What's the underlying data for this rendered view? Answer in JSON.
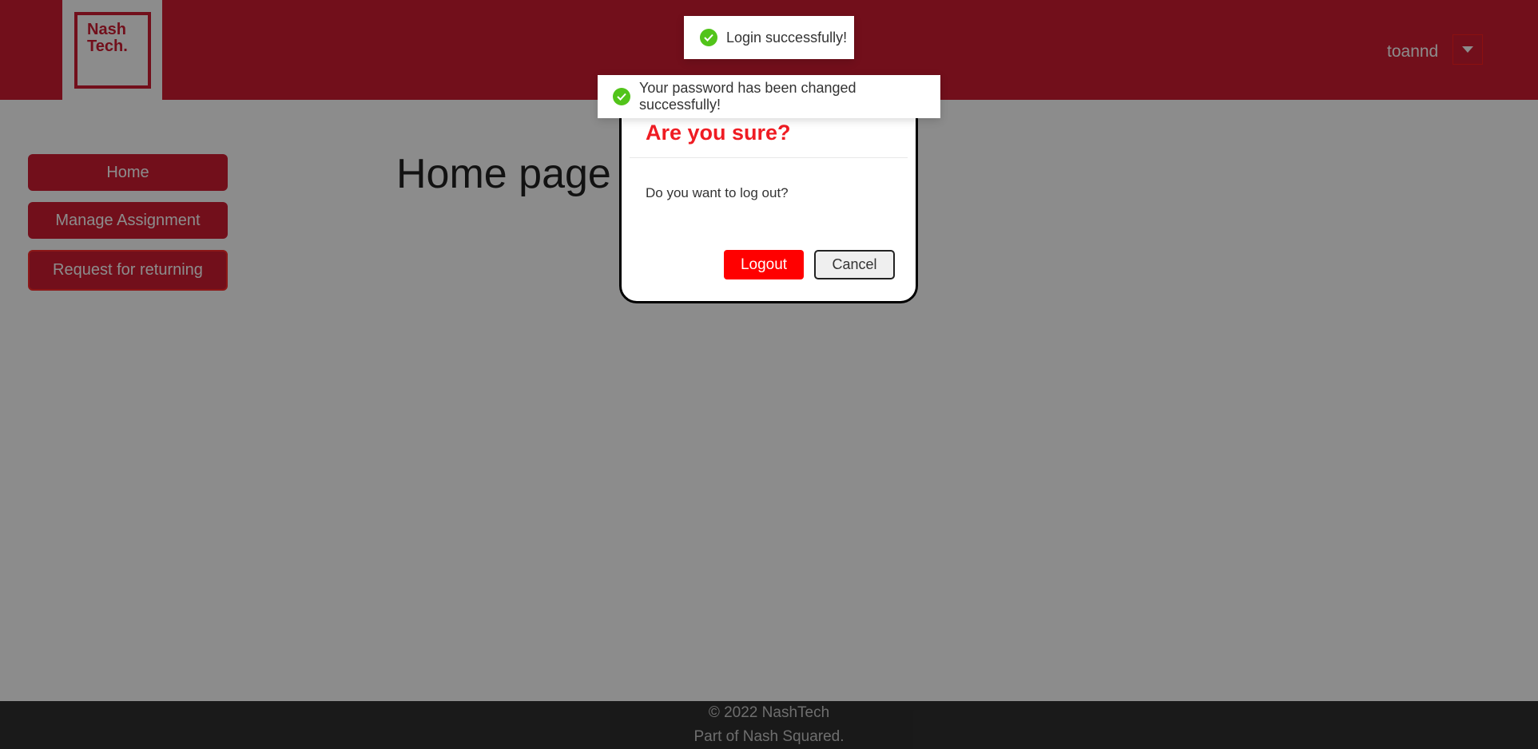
{
  "header": {
    "logo_text": "Nash\nTech.",
    "username": "toannd",
    "user_dropdown_icon": "caret-down-icon"
  },
  "sidebar": {
    "items": [
      {
        "label": "Home"
      },
      {
        "label": "Manage Assignment"
      },
      {
        "label": "Request for returning"
      }
    ]
  },
  "main": {
    "title": "Home page"
  },
  "footer": {
    "copyright": "© 2022 NashTech",
    "tagline": "Part of Nash Squared."
  },
  "modal": {
    "title": "Are you sure?",
    "message": "Do you want to log out?",
    "confirm_label": "Logout",
    "cancel_label": "Cancel"
  },
  "toasts": [
    {
      "message": "Login successfully!",
      "icon": "check-circle-icon"
    },
    {
      "message": "Your password has been changed successfully!",
      "icon": "check-circle-icon"
    }
  ],
  "colors": {
    "brand": "#cf1d32",
    "danger": "#ff0000",
    "success": "#52c41a",
    "footer_bg": "#2f2f2f"
  }
}
